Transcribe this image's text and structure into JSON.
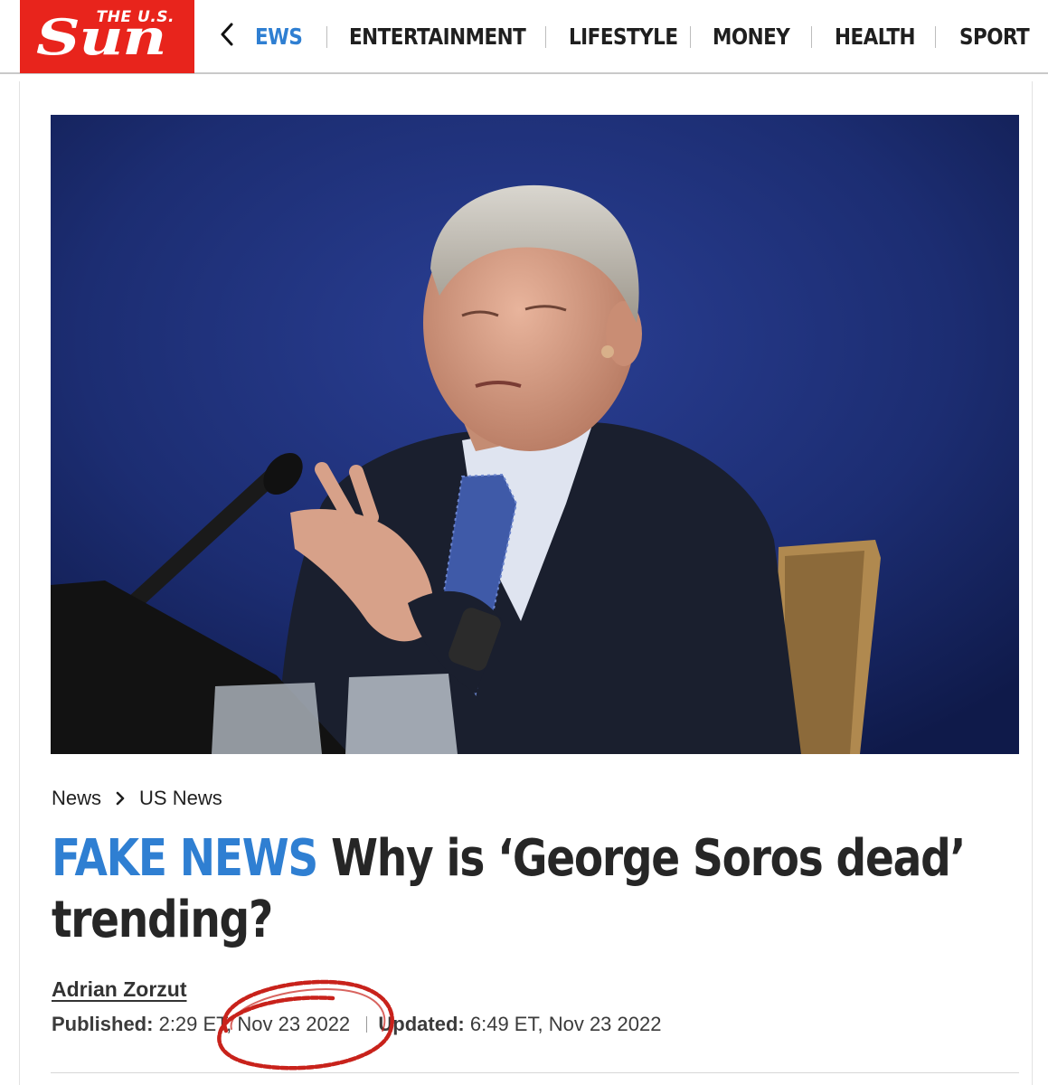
{
  "header": {
    "logo": {
      "small_text": "THE U.S.",
      "big_text": "Sun",
      "color": "#e8241c"
    },
    "back_icon": "chevron-left-icon",
    "nav": [
      {
        "label": "EWS",
        "active": true
      },
      {
        "label": "ENTERTAINMENT",
        "active": false
      },
      {
        "label": "LIFESTYLE",
        "active": false
      },
      {
        "label": "MONEY",
        "active": false
      },
      {
        "label": "HEALTH",
        "active": false
      },
      {
        "label": "SPORT",
        "active": false
      }
    ],
    "accent_color": "#2f7fd2"
  },
  "article": {
    "breadcrumb": [
      "News",
      "US News"
    ],
    "kicker": "FAKE NEWS",
    "title": "Why is ‘George Soros dead’ trending?",
    "author": "Adrian Zorzut",
    "published_label": "Published:",
    "published_value": "2:29 ET, Nov 23 2022",
    "updated_label": "Updated:",
    "updated_value": "6:49 ET, Nov 23 2022",
    "annotation": {
      "shape": "hand-drawn-ellipse",
      "color": "#c8221b"
    }
  }
}
